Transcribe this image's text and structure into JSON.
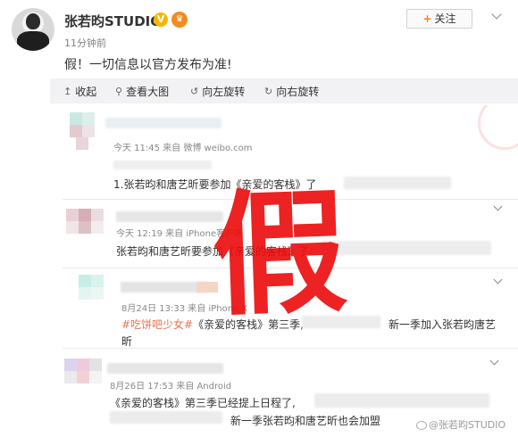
{
  "header": {
    "username": "张若昀STUDIO",
    "verified_badge": "V",
    "time": "11分钟前",
    "follow_label": "关注",
    "follow_plus": "+"
  },
  "post": {
    "text": "假！一切信息以官方发布为准!"
  },
  "toolbar": {
    "items": [
      {
        "icon": "↥",
        "label": "收起"
      },
      {
        "icon": "⚲",
        "label": "查看大图"
      },
      {
        "icon": "↺",
        "label": "向左旋转"
      },
      {
        "icon": "↻",
        "label": "向右旋转"
      }
    ]
  },
  "comments": [
    {
      "meta": "今天 11:45 来自 微博 weibo.com",
      "text": "1.张若昀和唐艺昕要参加《亲爱的客栈》了"
    },
    {
      "meta": "今天 12:19 来自 iPhone客户端",
      "text": "张若昀和唐艺昕要参加《亲爱的客栈》了"
    },
    {
      "meta": "8月24日 13:33 来自 iPhone X",
      "tag": "#吃饼吧少女#",
      "text": "《亲爱的客栈》第三季,",
      "text2": "新一季加入张若昀唐艺",
      "text3": "昕"
    },
    {
      "meta": "8月26日 17:53 来自 Android",
      "text": "《亲爱的客栈》第三季已经提上日程了,",
      "text2": "新一季张若昀和唐艺昕也会加盟"
    }
  ],
  "overlay": {
    "stamp_char": "假"
  },
  "watermark": "@张若昀STUDIO",
  "colors": {
    "accent": "#ff8200",
    "fake_red": "#eb0a0a",
    "tag": "#eb7350",
    "toolbar_bg": "#f2f2f5"
  }
}
